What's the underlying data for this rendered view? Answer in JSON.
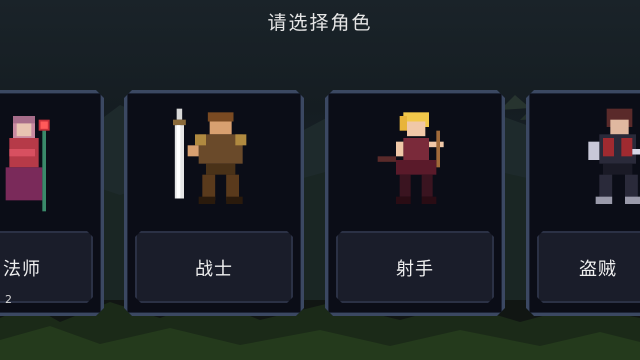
{
  "title": "请选择角色",
  "characters": [
    {
      "id": "mage",
      "label": "法师",
      "sub": "2",
      "sprite": "mage-sprite"
    },
    {
      "id": "warrior",
      "label": "战士",
      "sprite": "warrior-sprite"
    },
    {
      "id": "archer",
      "label": "射手",
      "sprite": "archer-sprite"
    },
    {
      "id": "rogue",
      "label": "盗贼",
      "sprite": "rogue-sprite"
    }
  ],
  "colors": {
    "background": "#151d22",
    "card_bg": "#0b0d17",
    "card_border": "#3b4862",
    "plate_bg": "#1a1d2a",
    "text": "#f0f0f0"
  }
}
